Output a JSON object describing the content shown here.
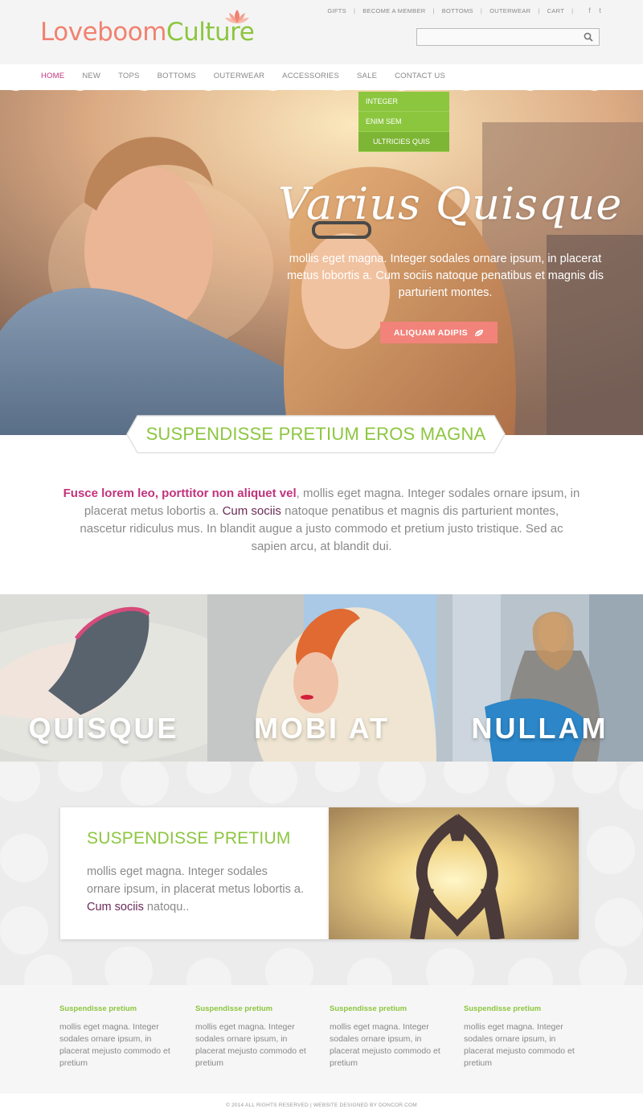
{
  "brand": {
    "part1": "Loveboom",
    "part2": "Culture"
  },
  "top_links": [
    "GIFTS",
    "BECOME A MEMBER",
    "BOTTOMS",
    "OUTERWEAR",
    "CART"
  ],
  "social": {
    "facebook": "f",
    "twitter": "t"
  },
  "search": {
    "placeholder": "",
    "value": ""
  },
  "nav": [
    "HOME",
    "NEW",
    "TOPS",
    "BOTTOMS",
    "OUTERWEAR",
    "ACCESSORIES",
    "SALE",
    "CONTACT US"
  ],
  "dropdown": [
    "INTEGER",
    "ENIM SEM",
    "ULTRICIES QUIS"
  ],
  "hero": {
    "title": "Varius Quisque",
    "text": "mollis eget magna. Integer sodales ornare ipsum, in placerat metus lobortis a. Cum sociis natoque penatibus et magnis dis parturient montes.",
    "button": "ALIQUAM ADIPIS"
  },
  "banner": "SUSPENDISSE PRETIUM EROS MAGNA",
  "intro": {
    "highlight": "Fusce lorem leo, porttitor non aliquet vel",
    "text1": ", mollis eget magna. Integer sodales ornare ipsum, in placerat metus lobortis a. ",
    "link": "Cum sociis",
    "text2": " natoque penatibus et magnis dis parturient montes, nascetur ridiculus mus. In blandit augue a justo commodo et pretium justo tristique. Sed ac sapien arcu, at blandit dui."
  },
  "tiles": [
    "QUISQUE",
    "MOBI AT",
    "NULLAM"
  ],
  "feature": {
    "title": "SUSPENDISSE PRETIUM",
    "text1": "mollis eget magna. Integer sodales ornare ipsum, in placerat metus lobortis a. ",
    "link": "Cum sociis",
    "text2": " natoqu.."
  },
  "footer_cols": [
    {
      "title": "Suspendisse pretium",
      "text": "mollis eget magna. Integer sodales ornare ipsum, in placerat mejusto commodo et pretium"
    },
    {
      "title": "Suspendisse pretium",
      "text": "mollis eget magna. Integer sodales ornare ipsum, in placerat mejusto commodo et pretium"
    },
    {
      "title": "Suspendisse pretium",
      "text": "mollis eget magna. Integer sodales ornare ipsum, in placerat mejusto commodo et pretium"
    },
    {
      "title": "Suspendisse pretium",
      "text": "mollis eget magna. Integer sodales ornare ipsum, in placerat mejusto commodo et pretium"
    }
  ],
  "copyright": "© 2014 ALL RIGHTS RESERVED | WEBSITE DESIGNED BY DONCOR.COM",
  "colors": {
    "pink": "#c2327c",
    "green": "#8cc63f",
    "coral": "#f2837a",
    "plum": "#6b2a57"
  }
}
